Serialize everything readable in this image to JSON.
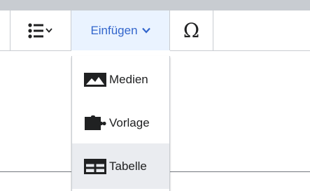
{
  "toolbar": {
    "list_icon": "bulleted-list-icon",
    "insert_label": "Einfügen",
    "special_char_label": "Ω"
  },
  "insert_menu": {
    "items": [
      {
        "label": "Medien",
        "icon": "image-icon"
      },
      {
        "label": "Vorlage",
        "icon": "puzzle-icon"
      },
      {
        "label": "Tabelle",
        "icon": "table-icon"
      }
    ],
    "highlighted_item": "Tabelle"
  },
  "colors": {
    "accent": "#3366cc",
    "insert_button_bg": "#eaf3ff",
    "menu_hover_bg": "#eaecf0",
    "border": "#c8ccd1",
    "text": "#202122"
  }
}
